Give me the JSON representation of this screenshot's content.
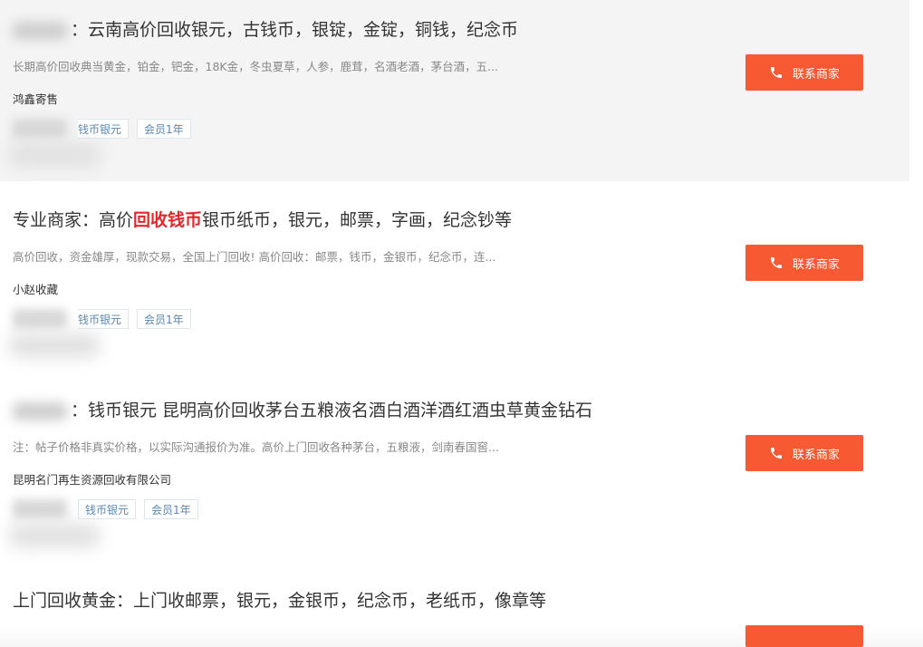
{
  "listings": [
    {
      "title_prefix": "：",
      "title_main": "云南高价回收银元，古钱币，银锭，金锭，铜钱，纪念币",
      "title_highlight": "",
      "title_suffix": "",
      "description": "长期高价回收典当黄金，铂金，钯金，18K金，冬虫夏草，人参，鹿茸，名酒老酒，茅台酒，五...",
      "company": "鸿鑫寄售",
      "tags": [
        "钱币银元",
        "会员1年"
      ],
      "button_label": "联系商家"
    },
    {
      "title_prefix": "专业商家：",
      "title_main": "高价",
      "title_highlight": "回收钱币",
      "title_suffix": "银币纸币，银元，邮票，字画，纪念钞等",
      "description": "高价回收，资金雄厚，现款交易，全国上门回收! 高价回收：邮票，钱币，金银币，纪念币，连...",
      "company": "小赵收藏",
      "tags": [
        "钱币银元",
        "会员1年"
      ],
      "button_label": "联系商家"
    },
    {
      "title_prefix": "：",
      "title_main": "钱币银元 昆明高价回收茅台五粮液名酒白酒洋酒红酒虫草黄金钻石",
      "title_highlight": "",
      "title_suffix": "",
      "description": "注：帖子价格非真实价格，以实际沟通报价为准。高价上门回收各种茅台，五粮液，剑南春国窖...",
      "company": "昆明名门再生资源回收有限公司",
      "tags": [
        "钱币银元",
        "会员1年"
      ],
      "button_label": "联系商家"
    },
    {
      "title_prefix": "上门回收黄金：",
      "title_main": "上门收邮票，银元，金银币，纪念币，老纸币，像章等",
      "title_highlight": "",
      "title_suffix": ""
    }
  ],
  "colors": {
    "button": "#f75933",
    "highlight_text": "#e4262b",
    "tag_text": "#5a86b0",
    "tag_border": "#dde6ee",
    "highlight_row_bg": "#f4f4f4"
  },
  "icons": {
    "button_icon": "phone-icon"
  }
}
